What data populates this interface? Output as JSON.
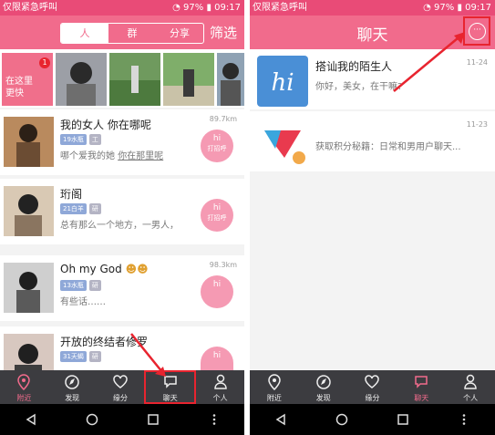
{
  "status_bar": {
    "carrier": "仅限紧急呼叫",
    "battery": "97%",
    "time": "09:17"
  },
  "left": {
    "tabs": [
      {
        "label": "人",
        "active": true
      },
      {
        "label": "群",
        "active": false
      },
      {
        "label": "分享",
        "active": false
      }
    ],
    "filter_label": "筛选",
    "banner": {
      "line1": "在这里",
      "line2": "更快",
      "badge": "1"
    },
    "users": [
      {
        "name": "我的女人 你在哪呢",
        "tags": [
          "19水瓶",
          "工"
        ],
        "bio_prefix": "哪个爱我的她",
        "bio_underlined": "你在那里呢",
        "distance": "89.7km",
        "greet_label": "打招呼"
      },
      {
        "name": "珩阁",
        "tags": [
          "21白羊",
          "研"
        ],
        "bio": "总有那么一个地方，一男人，",
        "distance": "",
        "greet_label": "打招呼"
      },
      {
        "name": "Oh my God",
        "tags": [
          "13水瓶",
          "研"
        ],
        "bio": "有些话……",
        "distance": "98.3km",
        "greet_label": ""
      },
      {
        "name": "开放的终结者修罗",
        "tags": [
          "31天蝎",
          "研"
        ],
        "bio": "",
        "distance": "",
        "greet_label": ""
      }
    ]
  },
  "right": {
    "title": "聊天",
    "more_icon": "···",
    "chats": [
      {
        "name": "搭讪我的陌生人",
        "message": "你好，美女，在干嘛?",
        "time": "11-24",
        "avatar_text": "hi"
      },
      {
        "name": "",
        "message": "获取积分秘籍：日常和男用户聊天...",
        "time": "11-23"
      }
    ]
  },
  "nav": [
    {
      "label": "附近",
      "icon": "location-pin-icon"
    },
    {
      "label": "发现",
      "icon": "compass-icon"
    },
    {
      "label": "缘分",
      "icon": "heart-icon"
    },
    {
      "label": "聊天",
      "icon": "chat-bubble-icon"
    },
    {
      "label": "个人",
      "icon": "person-icon"
    }
  ],
  "colors": {
    "brand_pink": "#f16b8c",
    "status_pink": "#e94b77",
    "highlight_red": "#e8242f",
    "nav_bg": "#3c3c40"
  }
}
